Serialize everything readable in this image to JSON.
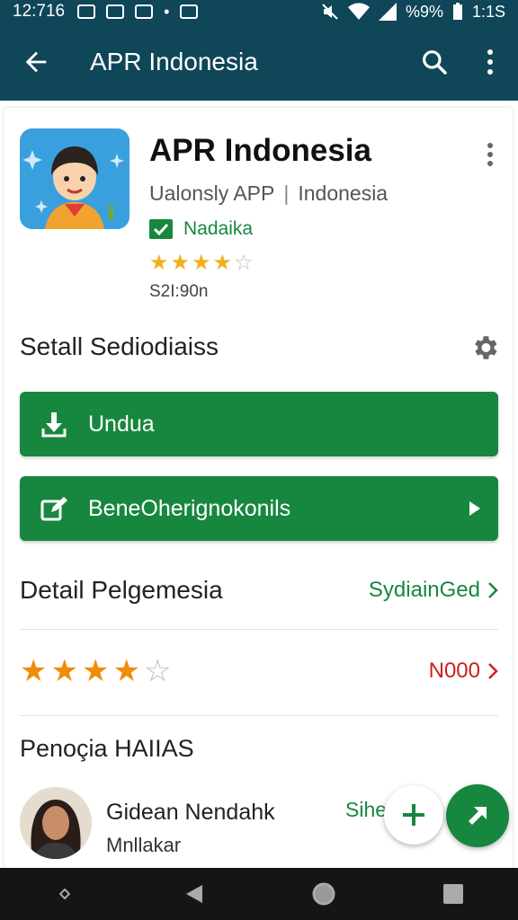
{
  "status_bar": {
    "time": "12:716",
    "battery_text": "%9%",
    "clock_right": "1:1S"
  },
  "app_bar": {
    "title": "APR Indonesia"
  },
  "app": {
    "name": "APR Indonesia",
    "developer": "Ualonsly APP",
    "category": "Indonesia",
    "badge": "Nadaika",
    "rating_stars": 4,
    "size": "S2I:90n"
  },
  "section_setting": "Setall Sediodiaiss",
  "buttons": {
    "download_label": "Undua",
    "secondary_label": "BeneOherignokonils"
  },
  "detail": {
    "label": "Detail Pelgemesia",
    "link": "SydiainGed"
  },
  "rating_row": {
    "stars": 4,
    "count": "N000"
  },
  "reviews_title": "Penoçia HAIIAS",
  "review": {
    "name": "Gidean Nendahk",
    "sub": "Mnllakar",
    "action": "Sihe"
  },
  "colors": {
    "app_bar": "#0f4658",
    "primary_green": "#17873f",
    "star_gold": "#f2b01e",
    "star_orange": "#f08c0a",
    "count_red": "#cc1f1f"
  }
}
